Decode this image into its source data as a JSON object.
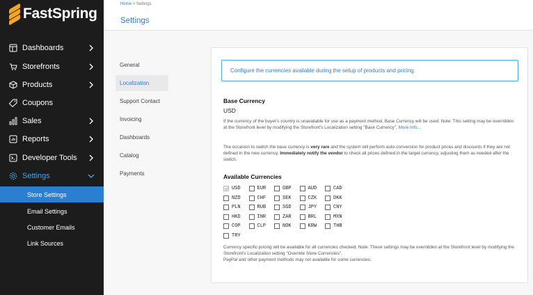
{
  "brand": {
    "name": "FastSpring",
    "accent": "#2b7fd0",
    "logo_color": "#f5a623"
  },
  "sidebar": {
    "items": [
      {
        "label": "Dashboards",
        "icon": "dashboard-icon",
        "has_chevron": true
      },
      {
        "label": "Storefronts",
        "icon": "cart-icon",
        "has_chevron": true
      },
      {
        "label": "Products",
        "icon": "box-icon",
        "has_chevron": true
      },
      {
        "label": "Coupons",
        "icon": "tag-icon",
        "has_chevron": false
      },
      {
        "label": "Sales",
        "icon": "sales-chart-icon",
        "has_chevron": true
      },
      {
        "label": "Reports",
        "icon": "report-icon",
        "has_chevron": true
      },
      {
        "label": "Developer Tools",
        "icon": "terminal-icon",
        "has_chevron": true
      },
      {
        "label": "Settings",
        "icon": "gear-icon",
        "has_chevron": true,
        "expanded": true
      }
    ],
    "sub_items": [
      {
        "label": "Store Settings",
        "active": true
      },
      {
        "label": "Email Settings"
      },
      {
        "label": "Customer Emails"
      },
      {
        "label": "Link Sources"
      }
    ]
  },
  "header": {
    "breadcrumb_home": "Home",
    "breadcrumb_sep": ">",
    "breadcrumb_current": "Settings",
    "title": "Settings"
  },
  "settings_nav": [
    {
      "label": "General"
    },
    {
      "label": "Localization",
      "active": true
    },
    {
      "label": "Support Contact"
    },
    {
      "label": "Invoicing"
    },
    {
      "label": "Dashboards"
    },
    {
      "label": "Catalog"
    },
    {
      "label": "Payments"
    }
  ],
  "panel": {
    "info": "Configure the currencies available during the setup of products and pricing.",
    "base_heading": "Base Currency",
    "base_value": "USD",
    "base_desc_1": "If the currency of the buyer's country is unavailable for use as a payment method, Base Currency will be used. Note: This setting may be overridden at the Storefront level by modifying the Storefront's Localization setting \"Base Currency\".",
    "more_info": "More Info...",
    "base_desc_2a": "The occasion to switch the base currency is",
    "base_desc_2b": "very rare",
    "base_desc_2c": "and the system will perform auto-conversion for product prices and discounts if they are not defined in the new currency.",
    "base_desc_2d": "Immediately notify the vendor",
    "base_desc_2e": "to check all prices defined in the target currency, adjusting them as needed after the switch.",
    "available_heading": "Available Currencies",
    "currencies": [
      [
        "USD",
        "EUR",
        "GBP",
        "AUD",
        "CAD"
      ],
      [
        "NZD",
        "CHF",
        "SEK",
        "CZK",
        "DKK"
      ],
      [
        "PLN",
        "RUB",
        "SGD",
        "JPY",
        "CNY"
      ],
      [
        "HKD",
        "INR",
        "ZAR",
        "BRL",
        "MXN"
      ],
      [
        "COP",
        "CLP",
        "NOK",
        "KRW",
        "THB"
      ],
      [
        "TRY"
      ]
    ],
    "checked": [
      "USD"
    ],
    "footer_1": "Currency specific pricing will be available for all currencies checked. Note: These settings may be overridden at the Storefront level by modifying the Storefront's Localization setting \"Override Store Currencies\".",
    "footer_2": "PayPal and other payment methods may not available for some currencies."
  }
}
